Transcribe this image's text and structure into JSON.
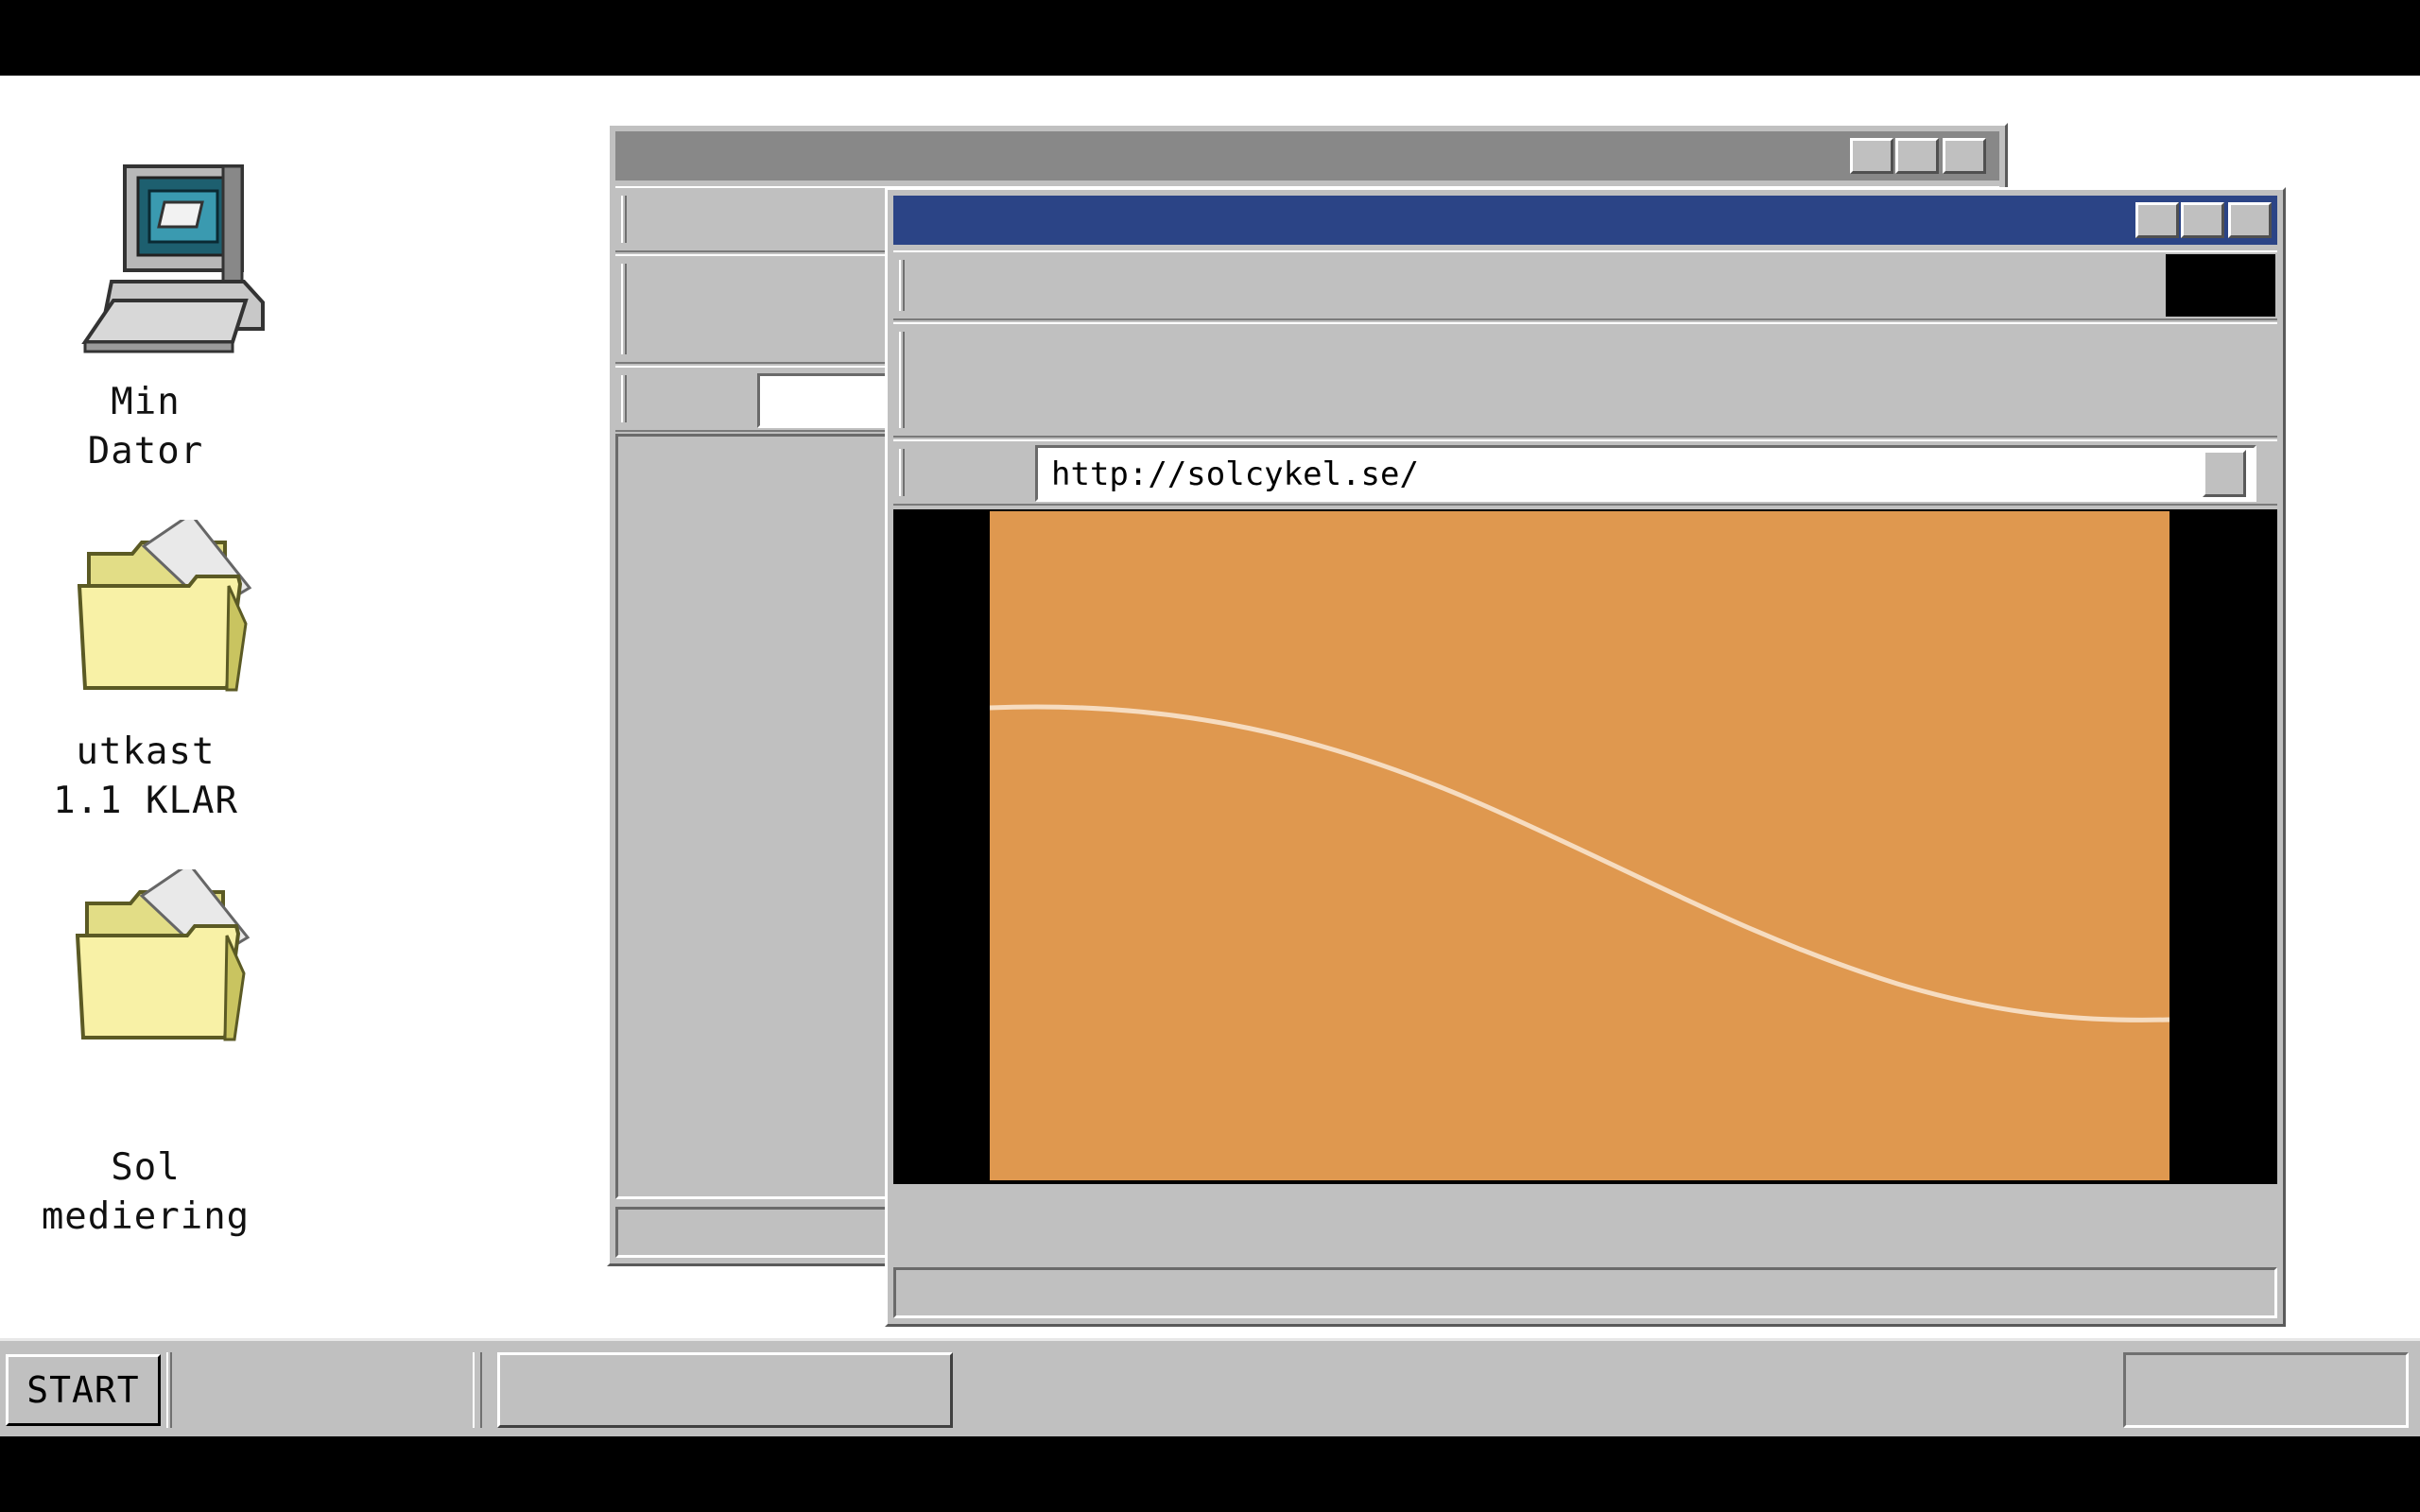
{
  "desktop": {
    "icons": [
      {
        "label": "Min\nDator",
        "icon": "computer-icon"
      },
      {
        "label": "utkast\n1.1 KLAR",
        "icon": "folder-icon"
      },
      {
        "label": "Sol\nmediering",
        "icon": "folder-icon"
      }
    ]
  },
  "browser": {
    "address": "http://solcykel.se/",
    "content_bg": "#df984f",
    "title_bar_color": "#2b4486"
  },
  "taskbar": {
    "start_label": "START"
  },
  "colors": {
    "desktop": "#ffffff",
    "window_face": "#c0c0c0",
    "inactive_title": "#888888",
    "active_title": "#2b4486",
    "canvas": "#df984f"
  }
}
